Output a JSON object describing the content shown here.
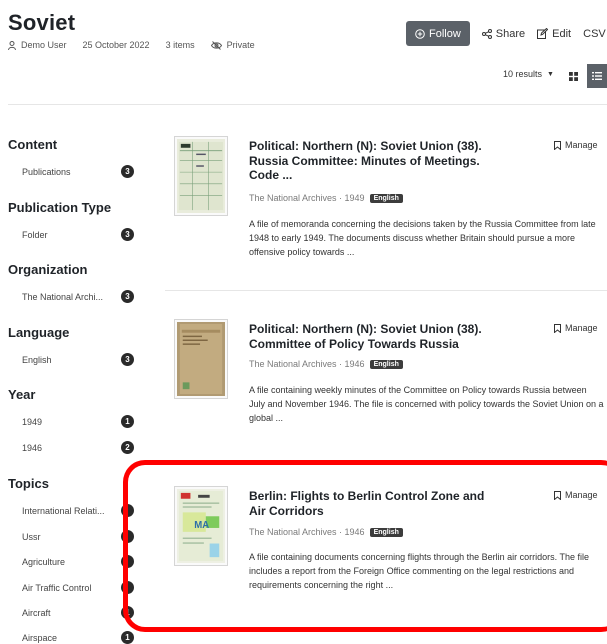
{
  "collection": {
    "title": "Soviet",
    "owner": "Demo User",
    "date": "25 October 2022",
    "items_count": "3 items",
    "visibility": "Private"
  },
  "actions": {
    "follow": "Follow",
    "share": "Share",
    "edit": "Edit",
    "csv": "CSV"
  },
  "view": {
    "results_per_page": "10 results"
  },
  "facets": {
    "content": {
      "heading": "Content",
      "items": [
        {
          "label": "Publications",
          "count": "3"
        }
      ]
    },
    "publication_type": {
      "heading": "Publication Type",
      "items": [
        {
          "label": "Folder",
          "count": "3"
        }
      ]
    },
    "organization": {
      "heading": "Organization",
      "items": [
        {
          "label": "The National Archi...",
          "count": "3"
        }
      ]
    },
    "language": {
      "heading": "Language",
      "items": [
        {
          "label": "English",
          "count": "3"
        }
      ]
    },
    "year": {
      "heading": "Year",
      "items": [
        {
          "label": "1949",
          "count": "1"
        },
        {
          "label": "1946",
          "count": "2"
        }
      ]
    },
    "topics": {
      "heading": "Topics",
      "items": [
        {
          "label": "International Relati...",
          "count": ""
        },
        {
          "label": "Ussr",
          "count": ""
        },
        {
          "label": "Agriculture",
          "count": ""
        },
        {
          "label": "Air Traffic Control",
          "count": ""
        },
        {
          "label": "Aircraft",
          "count": "1"
        },
        {
          "label": "Airspace",
          "count": "1"
        }
      ]
    }
  },
  "results": [
    {
      "title_line1": "Political: Northern (N): Soviet Union (38).",
      "title_line2": "Russia Committee: Minutes of Meetings.",
      "title_line3": "Code ...",
      "source": "The National Archives · 1949",
      "language": "English",
      "manage": "Manage",
      "description": "A file of memoranda concerning the decisions taken by the Russia Committee from late 1948 to early 1949. The documents discuss whether Britain should pursue a more offensive policy towards ..."
    },
    {
      "title_line1": "Political: Northern (N): Soviet Union (38).",
      "title_line2": "Committee of Policy Towards Russia",
      "source": "The National Archives · 1946",
      "language": "English",
      "manage": "Manage",
      "description": "A file containing weekly minutes of the Committee on Policy towards Russia between July and November 1946. The file is concerned with policy towards the Soviet Union on a global ..."
    },
    {
      "title_line1": "Berlin: Flights to Berlin Control Zone and",
      "title_line2": "Air Corridors",
      "source": "The National Archives · 1946",
      "language": "English",
      "manage": "Manage",
      "description": "A file containing documents concerning flights through the Berlin air corridors. The file includes a report from the Foreign Office commenting on the legal restrictions and requirements concerning the right ..."
    }
  ],
  "thumbnail_labels": {
    "result3_stamp": "MA"
  },
  "colors": {
    "highlight": "#ff0000",
    "dark_button": "#5b6168",
    "badge": "#2a2a2a"
  },
  "icons": {
    "owner": "user-icon",
    "private": "eye-slash-icon",
    "follow": "plus-circle-icon",
    "share": "share-icon",
    "edit": "edit-icon",
    "grid": "grid-view-icon",
    "list": "list-view-icon",
    "manage": "bookmark-icon"
  }
}
